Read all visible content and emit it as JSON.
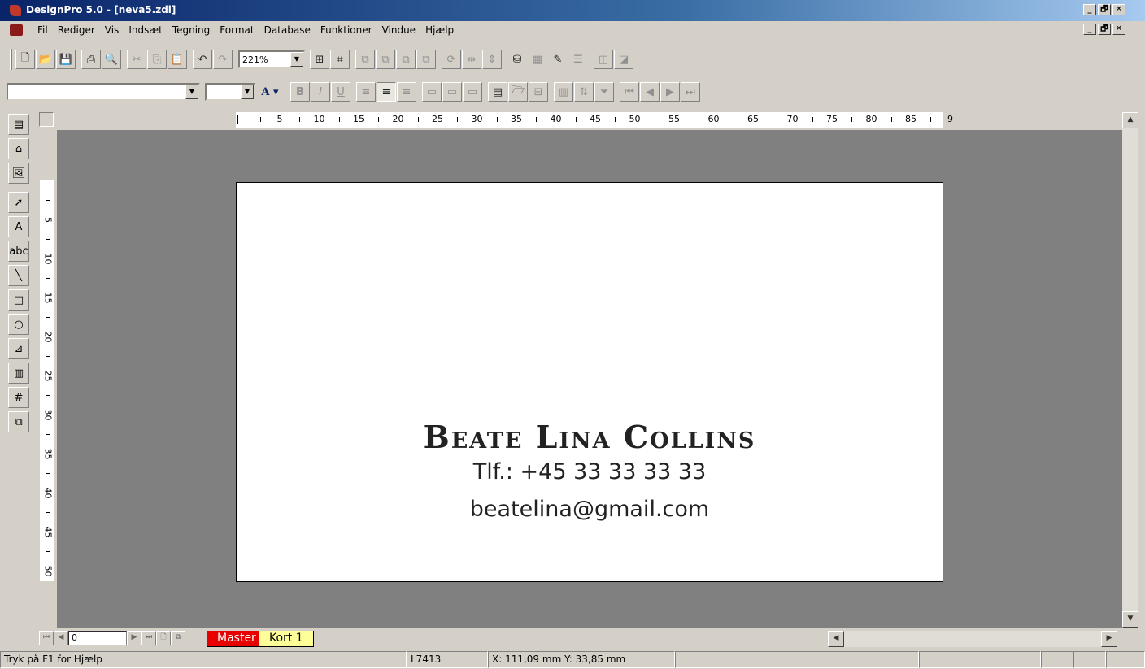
{
  "window": {
    "title": "DesignPro 5.0 - [neva5.zdl]",
    "controls": [
      "_",
      "🗗",
      "✕"
    ]
  },
  "menu": {
    "items": [
      "Fil",
      "Rediger",
      "Vis",
      "Indsæt",
      "Tegning",
      "Format",
      "Database",
      "Funktioner",
      "Vindue",
      "Hjælp"
    ]
  },
  "toolbar1": {
    "zoom": "221%"
  },
  "toolbar2": {
    "font_name": "",
    "font_size": "",
    "font_color_label": "A"
  },
  "ruler": {
    "h_labels": [
      "5",
      "10",
      "15",
      "20",
      "25",
      "30",
      "35",
      "40",
      "45",
      "50",
      "55",
      "60",
      "65",
      "70",
      "75",
      "80",
      "85",
      "9"
    ],
    "v_labels": [
      "5",
      "10",
      "15",
      "20",
      "25",
      "30",
      "35",
      "40",
      "45",
      "50"
    ]
  },
  "card": {
    "name": "Beate Lina Collins",
    "phone": "Tlf.: +45 33 33 33 33",
    "email": "beatelina@gmail.com"
  },
  "navigation": {
    "page": "0",
    "tabs": [
      "Master",
      "Kort 1"
    ]
  },
  "status": {
    "help": "Tryk på F1 for Hjælp",
    "label_code": "L7413",
    "coords": "X: 111,09 mm  Y: 33,85 mm"
  },
  "colors": {
    "workspace": "#808080",
    "master_tab": "#e80000",
    "kort_tab": "#ffff99"
  }
}
